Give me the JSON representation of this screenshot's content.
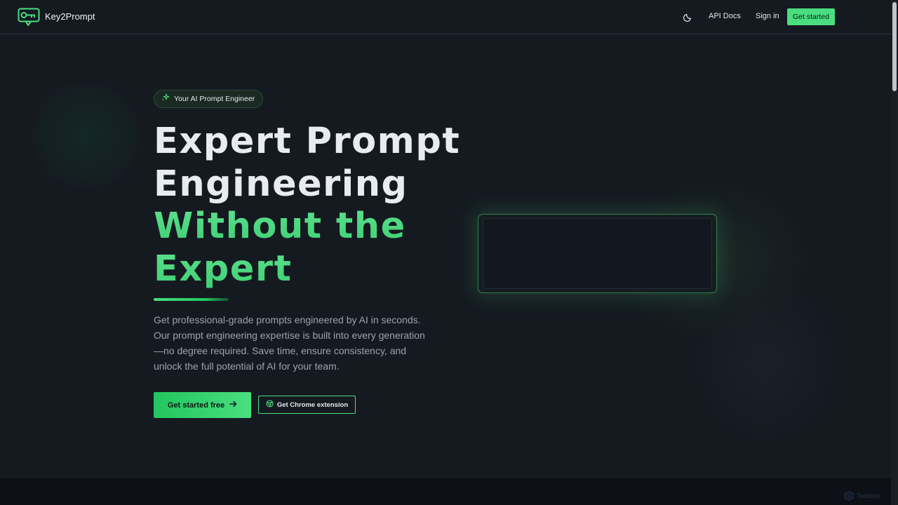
{
  "header": {
    "brand": "Key2Prompt",
    "theme_icon": "moon-icon",
    "nav": {
      "api_docs": "API Docs",
      "sign_in": "Sign in"
    },
    "cta": "Get started"
  },
  "hero": {
    "badge": "Your AI Prompt Engineer",
    "badge_icon": "sparkles-icon",
    "heading_lines_white": [
      "Expert Prompt",
      "Engineering"
    ],
    "heading_lines_green": [
      "Without the",
      "Expert"
    ],
    "description": "Get professional-grade prompts engineered by AI in seconds. Our prompt engineering expertise is built into every generation—no degree required. Save time, ensure consistency, and unlock the full potential of AI for your team.",
    "primary_cta": "Get started free",
    "secondary_cta": "Get Chrome extension",
    "secondary_cta_icon": "chrome-icon"
  },
  "watermark": "Tookbox",
  "colors": {
    "accent": "#4ade80",
    "background": "#151a21",
    "text": "#e8ebf0",
    "muted": "#9aa3ae"
  }
}
